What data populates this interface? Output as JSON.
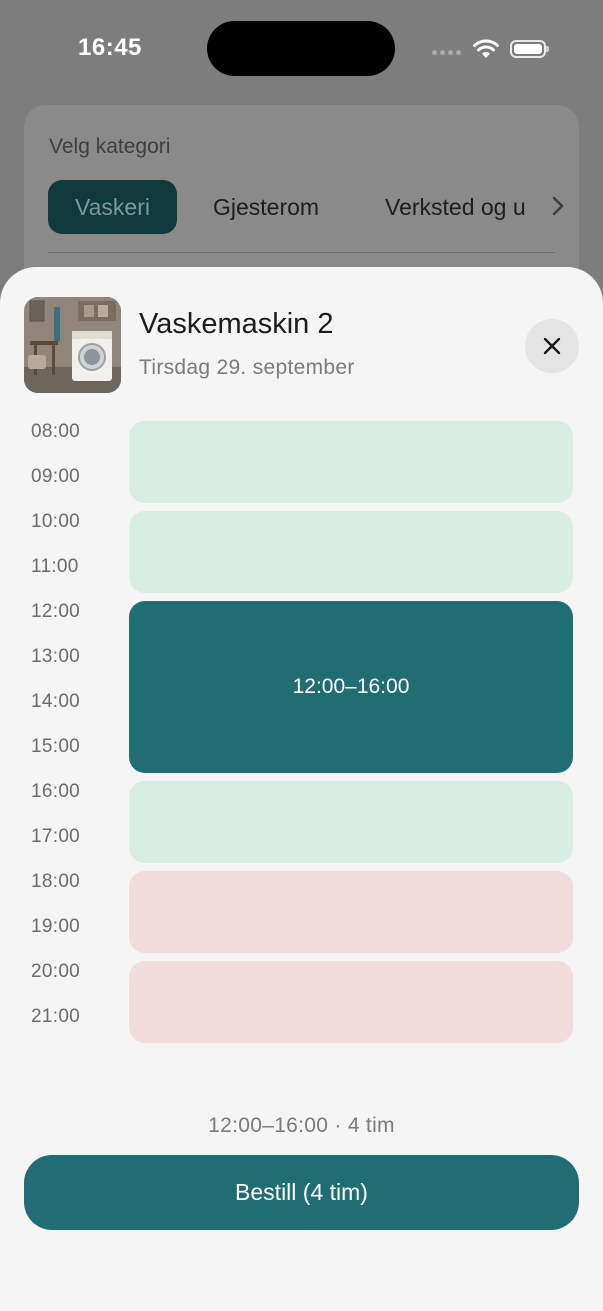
{
  "status_bar": {
    "time": "16:45",
    "icons": [
      "signal-dots-icon",
      "wifi-icon",
      "battery-icon"
    ]
  },
  "category_panel": {
    "title": "Velg kategori",
    "chips": [
      {
        "label": "Vaskeri",
        "selected": true
      },
      {
        "label": "Gjesterom",
        "selected": false
      },
      {
        "label": "Verksted og u",
        "selected": false
      }
    ],
    "more_icon": "chevron-right-icon"
  },
  "sheet": {
    "thumbnail_icon": "washing-machine-photo",
    "title": "Vaskemaskin 2",
    "subtitle": "Tirsdag 29. september",
    "close_icon": "close-icon",
    "hours": [
      "08:00",
      "09:00",
      "10:00",
      "11:00",
      "12:00",
      "13:00",
      "14:00",
      "15:00",
      "16:00",
      "17:00",
      "18:00",
      "19:00",
      "20:00",
      "21:00"
    ],
    "slots": [
      {
        "start": "08:00",
        "end": "10:00",
        "status": "available"
      },
      {
        "start": "10:00",
        "end": "12:00",
        "status": "available"
      },
      {
        "start": "12:00",
        "end": "16:00",
        "status": "selected",
        "label": "12:00–16:00"
      },
      {
        "start": "16:00",
        "end": "18:00",
        "status": "available"
      },
      {
        "start": "18:00",
        "end": "20:00",
        "status": "unavailable"
      },
      {
        "start": "20:00",
        "end": "22:00",
        "status": "unavailable"
      }
    ],
    "summary": "12:00–16:00 · 4 tim",
    "book_label": "Bestill (4 tim)"
  },
  "colors": {
    "accent": "#206d73",
    "available": "#d8ede3",
    "unavailable": "#f1dcdc",
    "overlay": "#7d7d7d"
  }
}
